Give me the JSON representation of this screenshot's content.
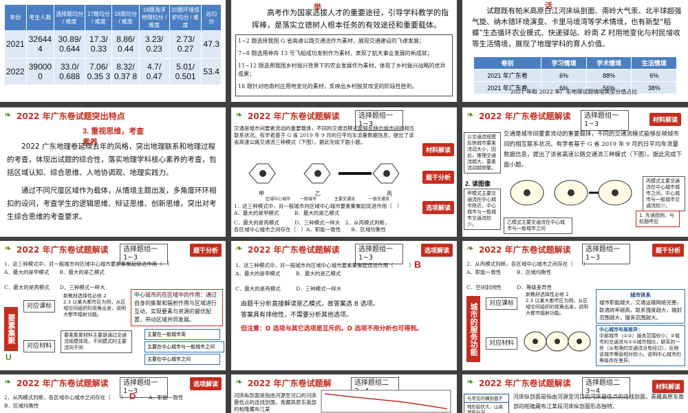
{
  "slide1": {
    "headers": [
      "年份",
      "考生人数",
      "选择题均分 / 难度",
      "17题均分 / 难度",
      "18题均分 / 难度",
      "19题海洋地理均分 / 难度",
      "20题环境保护均分 / 难度",
      "总均分"
    ],
    "rows": [
      [
        "2021",
        "32644 4",
        "30.89/ 0.644",
        "17.3/ 0.33",
        "8.86/ 0.44",
        "3.23/ 0.23",
        "2.73/ 0.27",
        "47.3"
      ],
      [
        "2022",
        "39000 0",
        "33.0/ 0.688",
        "7.06/ 0.35 3",
        "8.32/ 0.37 8",
        "4.7/ 0.47",
        "5.01/ 0.501",
        "53.4"
      ]
    ]
  },
  "slide2": {
    "top": "举",
    "para": "高考作为国家选拔人才的重要途径，引导学科教学的指挥棒，是落实立德树人根本任务的有效途径和重要载体。",
    "items": [
      "1~2 题选择我国 G 省高速公路交通流作为素材，展现交通建设的飞速发展；",
      "7~8 题选用神舟 13 号飞船成功发射作为素材，表现了航天事业发展的新成就；",
      "11~12 题选用我国乡村振兴背景下的农业发展作为素材，体现了乡村振兴战略的优异成果；",
      "18 题针对哈南村庄用地变化的素材，反映出乡村脱贫攻坚的阶段性胜利。"
    ]
  },
  "slide3": {
    "top": "活",
    "para": "试题既有帕米高原白江河床纵剖面、南岭大气汞、北半球超强气旋、纳木错环境演变、卡里马境湾等学术情境，也有新型“稻蝶”生态循环农业模式、快递驿站、岭南 Z 村用地变化与村民增收等生活情境，展现了地理学科的育人价值。",
    "headers": [
      "卷别",
      "学习情境",
      "学术情境",
      "生活情境"
    ],
    "rows": [
      [
        "2021 年广东卷",
        "6%",
        "88%",
        "6%"
      ],
      [
        "2021 年广东卷",
        "6%",
        "56%",
        "38%"
      ]
    ],
    "caption": "2021 年和 2022 年广东地理试题情境类型分值占比"
  },
  "slide4": {
    "title": "2022 年广东卷试题突出特点",
    "sub": "3. 重视思维，考查素养",
    "p1": "2022 广东地理卷延续去年的风格，突出地理联系和地理过程的考查，体现出试题的综合性，落实地理学科核心素养的考查，包括区域认知、综合思维、人地协调观、地理实践力。",
    "p2": "通过不同尺度区域作为载体，从情境主题出发，多角度环环相扣的设问，考查学生的逻辑思维、辩证思维、创新思维，突出对考生综合思维的考查要求。"
  },
  "slide5": {
    "title": "2022 年广东卷试题解读",
    "box": "选择题组一 1~3",
    "intro": "交通是城市间要素流动的重要载体，不同的交通流模式能够反映出城市间的相互联系状况。有学者基于 G 省 2019 年 9 月的日平均车流量数据信息，提出了该省高速公路交通流三种模式（下图）。据此完成下面小题。",
    "labels": [
      "甲",
      "乙",
      "丙"
    ],
    "legend": [
      "区域中心城市",
      "一般城市",
      "主要交通流",
      "一般交通流"
    ],
    "q1": "1．这三种模式中，对一般城市向区域中心城市要素集聚起促进作用（　）",
    "q1a": "A．最大的是甲模式　　　B．最大的是乙模式",
    "q1c": "C．最大的是丙模式　　　D．三种模式一样大　2．从丙模式判断，",
    "q2": "各区域中心城市之间存在（　）A．职能一致性　　B．区域均衡性",
    "tags": [
      "材料解读",
      "题干分析",
      "选项解读"
    ]
  },
  "slide6": {
    "title": "2022 年广东卷试题解读",
    "box": "选择题组一 1~3",
    "tag": "材料解读",
    "left1": "以交通流规模反映城市要素流动大小，因此，推理交通流越大，要素流动越频繁。",
    "text": "交通是城市间要素流动的重要载体，不同的交通流模式能够反映城市间的相互联系状况。有学者基于 G 省 2019 年 9 月的日平均车流量数据信息，提出了该省高速公路交通流三种模式（下图）。据此完成下面小题。",
    "sec2": "2. 读图像",
    "left2": "甲模式主要交通流在中心城市附近，中心城市与一般城市交通流较少。",
    "right2": "丙模式主要交通流在中心城市城市之间，中心城市与一般城市交通流较少。",
    "bottom": "乙模式主要交通流在中心城市与一般城市之间",
    "note": "1. 先读图例，与标题呼应"
  },
  "slide7": {
    "title": "2022 年广东卷试题解读",
    "box": "选择题组一 1~3",
    "tag": "题干分析",
    "q1": "1．这三种模式中，对一般城市向区域中心城市要素集聚起促进作用（　）",
    "q1a": "A．最大的是甲模式　　B．最大的是乙模式",
    "q1c": "C．最大的是丙模式　　D．三种模式一样大",
    "vlab": "要素集聚",
    "k1": "对应课标",
    "k1t": "新教材选择性必修 2\n2.3 以某大都市区为例，从区域空间组织的视角出发，说明大都市辐射功能。",
    "k2": "对应材料",
    "k2t": "要素集聚材料主要是通过交通流规模体现，不同模式的主要流向不同",
    "center": "中心城市的在区域中的作用：通过自身的集聚和辐射作用与区域进行互动，实现要素与资源的最优配置，带动区域共同发展。",
    "m1": "主要在一般城市周",
    "m2": "主要在中心城市与一般城市之间",
    "m3": "主要在中心城市之间"
  },
  "slide8": {
    "q1": "1．这三种模式中，对一般城市向区域中心城市要素集聚起促进作用（　　　）",
    "ans": "B",
    "q1a": "A．最大的是甲模式　　　B．最大的是乙模式",
    "q1c": "C．最大的是丙模式　　　D．三种模式一样大",
    "p1": "由题干分析直接解读是乙模式，故答案选 B 选项。",
    "p2": "答案具有排他性，不需要分析其他选项。",
    "p3": "但注意：D 选项与其它选项是互斥的。D 选项不用分析也可得到。"
  },
  "slide9": {
    "title": "2022 年广东卷试题解读",
    "box": "选择题组一 1~3",
    "tag": "题干分析",
    "q2": "2．从丙模式判断，各区域中心城市之间存在（　　）",
    "q2a": "A．职能一致性　　　B．区域均衡性",
    "q2c": "C．空间封闭性　　　D．等级差异性",
    "vlab": "城市的服务功能",
    "k1": "对应课标",
    "k1t": "新教材选择性必修 2\n2.3 以某大都市区为例，从区域空间组织的视角出发，说明大都市辐射功能。",
    "k2": "对应材料",
    "sys": "城市体系",
    "syst": "城市职能越大，交通运输网络完善，联通效率越高，联系强度越大，辐射范围越大，服务范围越大。",
    "diff": "中心城市布局差异：",
    "difft": "中部城市（①②）服务范围较小；②城市的交通流与①②城市相比，联系的一些（从有限的交通流没有经过），反映该城市等级相对较小。说明中心城市的等级存在差异。"
  },
  "slide10": {
    "title": "2022 年广东卷试题解读",
    "box": "选择题组一 1~3",
    "tag": "选项解读",
    "q2": "2．从丙模式判断，各区域中心城市之间存在（　　）",
    "ans": "D",
    "q2b": "A．职能一致性",
    "q2c": "B．区域均衡性"
  },
  "slide11": {
    "title": "2022 年广东卷试题解",
    "box": "选择题组二 3~4",
    "text": "河床纵剖面是指由河源至河口的河床最低点的连线剖面。青藏高原东南部的帕隆藏布江某"
  },
  "slide12": {
    "title": "2022 年广东卷试题解读",
    "box": "选择题组二 3~4",
    "tag": "材料解读",
    "l1": "与常见的横剖面不同",
    "l2": "地形起伏大，山高坡陡谷深",
    "text": "河床纵剖面是指由河源至河口的河床最低点的连线剖面。青藏高原东南部的帕隆藏布江某段河床纵剖面形态独特，"
  }
}
